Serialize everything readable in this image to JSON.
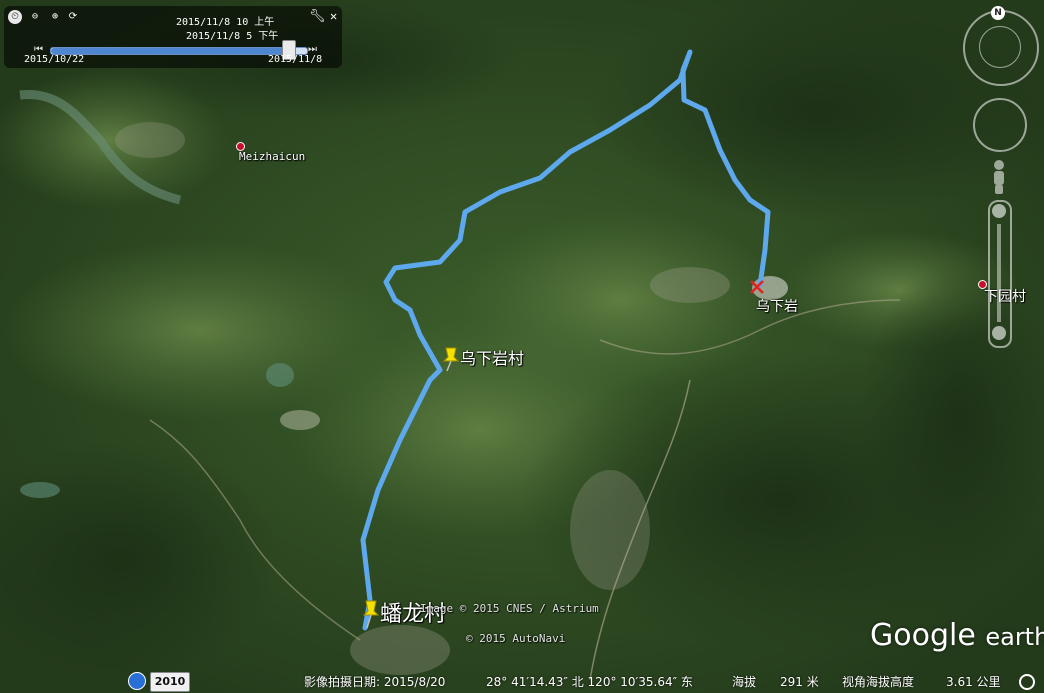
{
  "time_slider": {
    "top_time": "2015/11/8  10 上午",
    "current_time": "2015/11/8   5 下午",
    "start_date": "2015/10/22",
    "end_date": "2015/11/8",
    "position": 0.93
  },
  "nav": {
    "north_label": "N"
  },
  "places": {
    "wuxiayan_cun": "乌下岩村",
    "wuxiayan": "乌下岩",
    "panlong_cun": "蟠龙村",
    "meizhaicun": "Meizhaicun",
    "xiayuan_cun": "下园村"
  },
  "attribution": {
    "image": "Image © 2015 CNES / Astrium",
    "data": "© 2015 AutoNavi",
    "logo_google": "Google",
    "logo_earth": "earth"
  },
  "status": {
    "year": "2010",
    "imagery_date": "影像拍摄日期: 2015/8/20",
    "coords": "28° 41′14.43″ 北 120° 10′35.64″ 东",
    "elev_label": "海拔",
    "elev_value": "291 米",
    "eye_label": "视角海拔高度",
    "eye_value": "3.61 公里"
  },
  "colors": {
    "track": "#5ea8ee",
    "pin": "#f5e100",
    "poi": "#c8102e"
  }
}
